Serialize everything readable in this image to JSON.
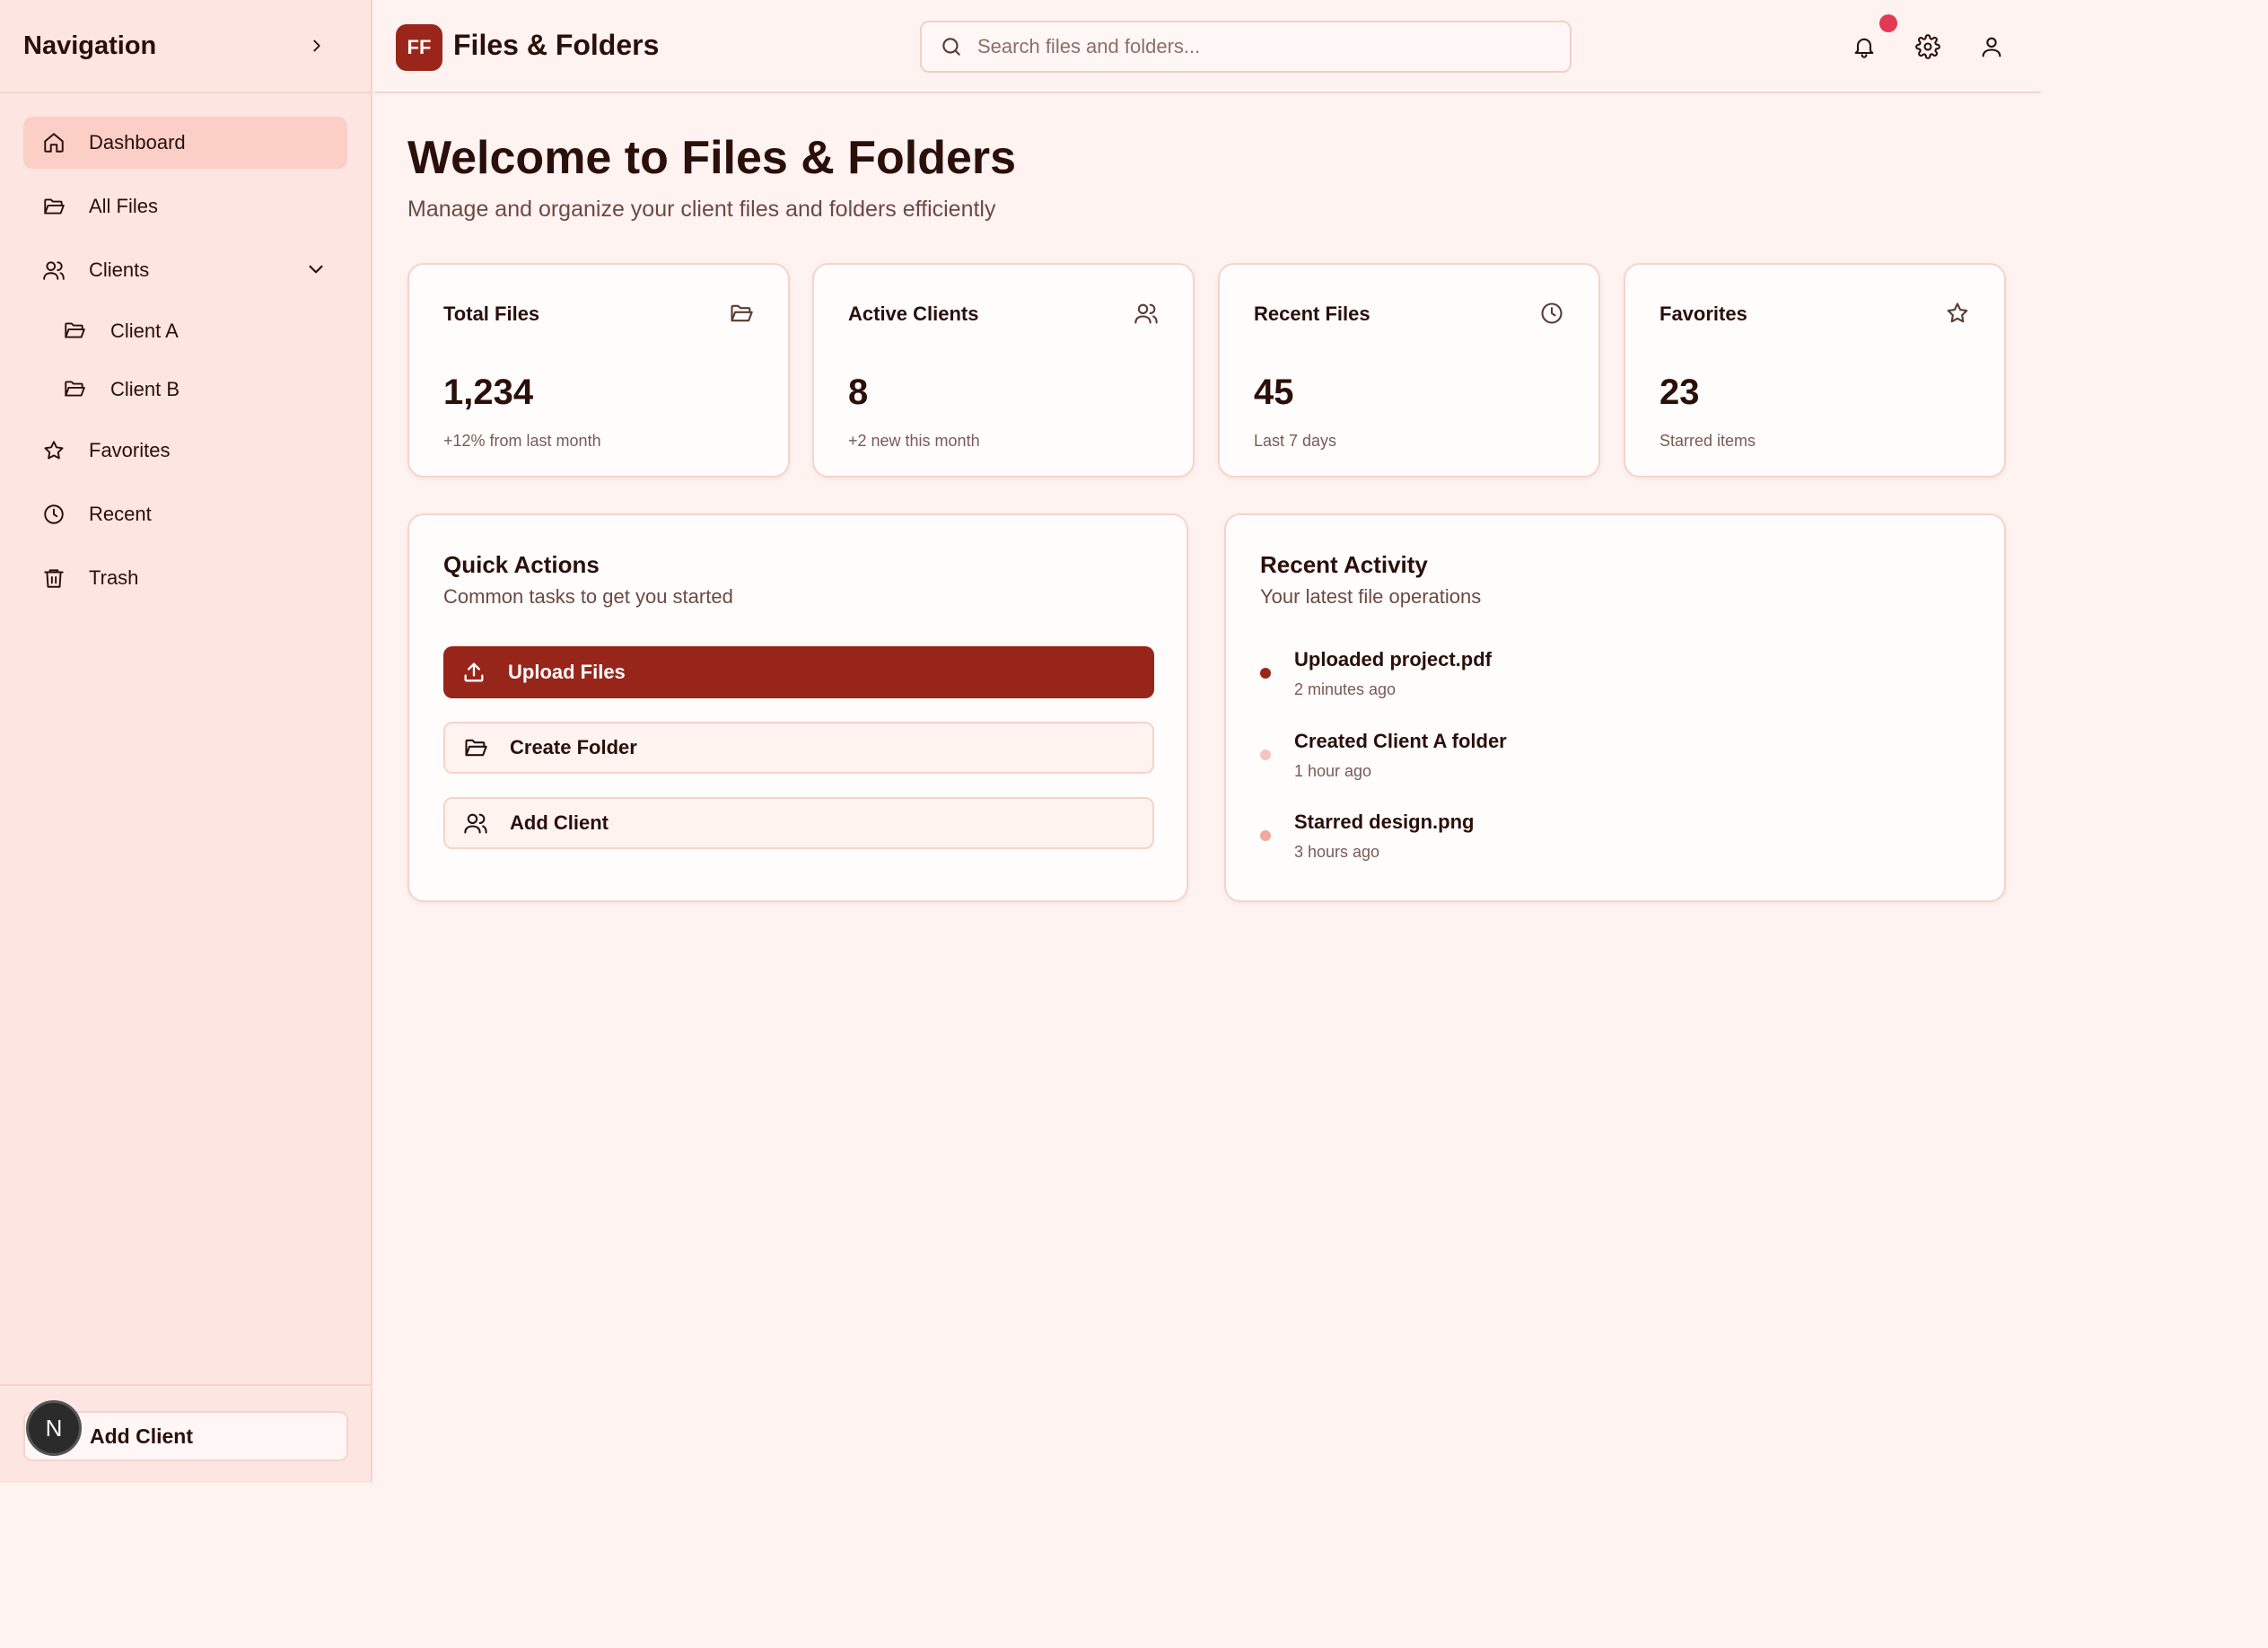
{
  "sidebar": {
    "title": "Navigation",
    "items": [
      {
        "label": "Dashboard",
        "icon": "home-icon"
      },
      {
        "label": "All Files",
        "icon": "folder-icon"
      },
      {
        "label": "Clients",
        "icon": "users-icon"
      },
      {
        "label": "Favorites",
        "icon": "star-icon"
      },
      {
        "label": "Recent",
        "icon": "clock-icon"
      },
      {
        "label": "Trash",
        "icon": "trash-icon"
      }
    ],
    "clients": [
      {
        "label": "Client A",
        "icon": "folder-icon"
      },
      {
        "label": "Client B",
        "icon": "folder-icon"
      }
    ],
    "footer_button": "Add Client",
    "badge_letter": "N"
  },
  "header": {
    "logo_text": "FF",
    "title": "Files & Folders",
    "search_placeholder": "Search files and folders..."
  },
  "main": {
    "welcome_title": "Welcome to Files & Folders",
    "welcome_subtitle": "Manage and organize your client files and folders efficiently",
    "stats": [
      {
        "label": "Total Files",
        "value": "1,234",
        "note": "+12% from last month",
        "icon": "folder-icon"
      },
      {
        "label": "Active Clients",
        "value": "8",
        "note": "+2 new this month",
        "icon": "users-icon"
      },
      {
        "label": "Recent Files",
        "value": "45",
        "note": "Last 7 days",
        "icon": "clock-icon"
      },
      {
        "label": "Favorites",
        "value": "23",
        "note": "Starred items",
        "icon": "star-icon"
      }
    ],
    "quick_actions": {
      "title": "Quick Actions",
      "subtitle": "Common tasks to get you started",
      "buttons": [
        {
          "label": "Upload Files",
          "icon": "upload-icon"
        },
        {
          "label": "Create Folder",
          "icon": "folder-icon"
        },
        {
          "label": "Add Client",
          "icon": "users-icon"
        }
      ]
    },
    "recent_activity": {
      "title": "Recent Activity",
      "subtitle": "Your latest file operations",
      "items": [
        {
          "title": "Uploaded project.pdf",
          "time": "2 minutes ago",
          "dot_color": "#9a261b"
        },
        {
          "title": "Created Client A folder",
          "time": "1 hour ago",
          "dot_color": "#f6c5bd"
        },
        {
          "title": "Starred design.png",
          "time": "3 hours ago",
          "dot_color": "#f0a99c"
        }
      ]
    }
  },
  "colors": {
    "accent": "#98251a",
    "notification": "#e23a54",
    "sidebar_bg": "#fde6e2",
    "page_bg": "#fff3f1"
  }
}
